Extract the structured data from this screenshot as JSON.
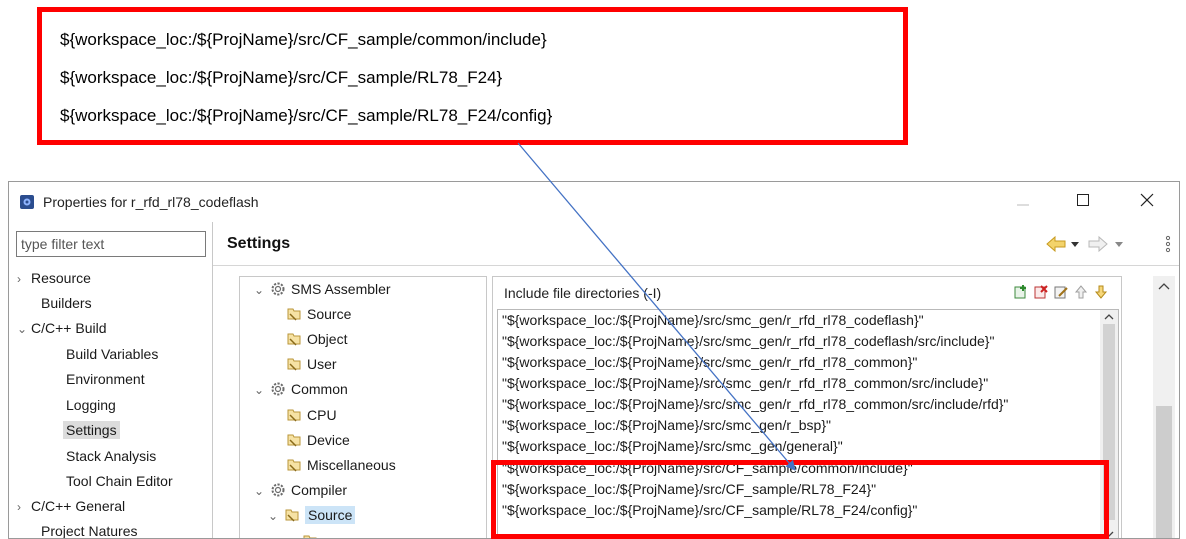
{
  "callout": {
    "lines": [
      "${workspace_loc:/${ProjName}/src/CF_sample/common/include}",
      "${workspace_loc:/${ProjName}/src/CF_sample/RL78_F24}",
      "${workspace_loc:/${ProjName}/src/CF_sample/RL78_F24/config}"
    ]
  },
  "window": {
    "title": "Properties for r_rfd_rl78_codeflash"
  },
  "filter": {
    "placeholder": "type filter text"
  },
  "nav": {
    "items": [
      {
        "label": "Resource",
        "twisty": "›"
      },
      {
        "label": "Builders"
      },
      {
        "label": "C/C++ Build",
        "twisty": "⌄"
      },
      {
        "label": "Build Variables"
      },
      {
        "label": "Environment"
      },
      {
        "label": "Logging"
      },
      {
        "label": "Settings"
      },
      {
        "label": "Stack Analysis"
      },
      {
        "label": "Tool Chain Editor"
      },
      {
        "label": "C/C++ General",
        "twisty": "›"
      },
      {
        "label": "Project Natures"
      }
    ]
  },
  "settings": {
    "title": "Settings"
  },
  "tool_tree": {
    "items": [
      {
        "label": "SMS Assembler",
        "twisty": "⌄"
      },
      {
        "label": "Source"
      },
      {
        "label": "Object"
      },
      {
        "label": "User"
      },
      {
        "label": "Common",
        "twisty": "⌄"
      },
      {
        "label": "CPU"
      },
      {
        "label": "Device"
      },
      {
        "label": "Miscellaneous"
      },
      {
        "label": "Compiler",
        "twisty": "⌄"
      },
      {
        "label": "Source",
        "twisty": "⌄"
      }
    ]
  },
  "options": {
    "label": "Include file directories (-I)",
    "directories": [
      "\"${workspace_loc:/${ProjName}/src/smc_gen/r_rfd_rl78_codeflash}\"",
      "\"${workspace_loc:/${ProjName}/src/smc_gen/r_rfd_rl78_codeflash/src/include}\"",
      "\"${workspace_loc:/${ProjName}/src/smc_gen/r_rfd_rl78_common}\"",
      "\"${workspace_loc:/${ProjName}/src/smc_gen/r_rfd_rl78_common/src/include}\"",
      "\"${workspace_loc:/${ProjName}/src/smc_gen/r_rfd_rl78_common/src/include/rfd}\"",
      "\"${workspace_loc:/${ProjName}/src/smc_gen/r_bsp}\"",
      "\"${workspace_loc:/${ProjName}/src/smc_gen/general}\"",
      "\"${workspace_loc:/${ProjName}/src/CF_sample/common/include}\"",
      "\"${workspace_loc:/${ProjName}/src/CF_sample/RL78_F24}\"",
      "\"${workspace_loc:/${ProjName}/src/CF_sample/RL78_F24/config}\""
    ]
  },
  "colors": {
    "highlight": "#ff0000",
    "arrow": "#4472c4",
    "selection": "#cce4f7"
  }
}
